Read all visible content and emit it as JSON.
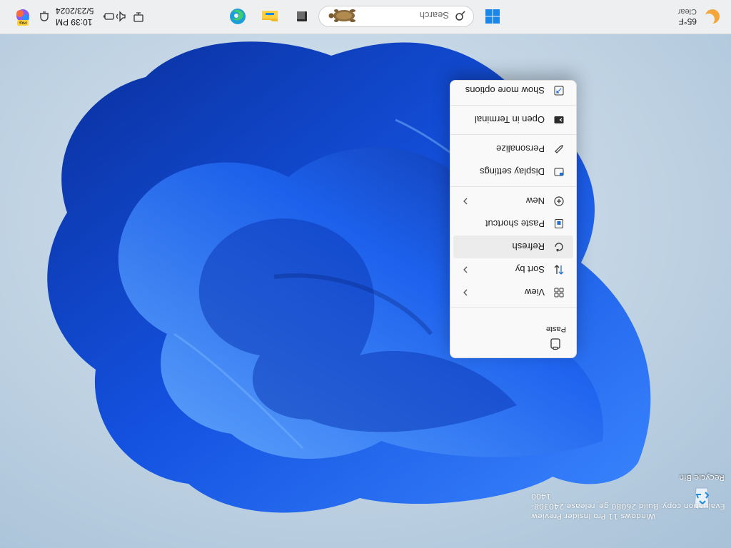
{
  "desktop": {
    "recycle_bin_label": "Recycle Bin"
  },
  "watermark": {
    "line1": "Windows 11 Pro Insider Preview",
    "line2": "Evaluation copy. Build 26080.ge_release.240308-1400"
  },
  "context_menu": {
    "paste_label": "Paste",
    "items": [
      {
        "label": "View",
        "icon": "grid-icon",
        "submenu": true
      },
      {
        "label": "Sort by",
        "icon": "sort-arrows-icon",
        "submenu": true
      },
      {
        "label": "Refresh",
        "icon": "refresh-icon",
        "submenu": false,
        "hovered": true
      },
      {
        "label": "Paste shortcut",
        "icon": "paste-shortcut-icon",
        "submenu": false
      },
      {
        "label": "New",
        "icon": "plus-circle-icon",
        "submenu": true
      },
      {
        "label": "Display settings",
        "icon": "display-icon",
        "submenu": false
      },
      {
        "label": "Personalize",
        "icon": "pencil-icon",
        "submenu": false
      },
      {
        "label": "Open in Terminal",
        "icon": "terminal-icon",
        "submenu": false
      },
      {
        "label": "Show more options",
        "icon": "expand-icon",
        "submenu": false
      }
    ]
  },
  "taskbar": {
    "weather": {
      "temp": "65°F",
      "condition": "Clear",
      "icon": "moon-icon"
    },
    "search_placeholder": "Search",
    "pinned": [
      "start-icon",
      "task-view-icon",
      "file-explorer-icon",
      "edge-icon"
    ],
    "clock": {
      "time": "10:39 PM",
      "date": "5/23/2024"
    },
    "tray": [
      "network-icon",
      "volume-icon",
      "battery-icon"
    ],
    "corner_badge": "PRE"
  },
  "colors": {
    "wallpaper_light": "#c7d8e6",
    "bloom_dark": "#0a2fa8",
    "bloom_mid": "#1d5ee8",
    "bloom_light": "#4f9bff",
    "accent": "#0067c0"
  }
}
